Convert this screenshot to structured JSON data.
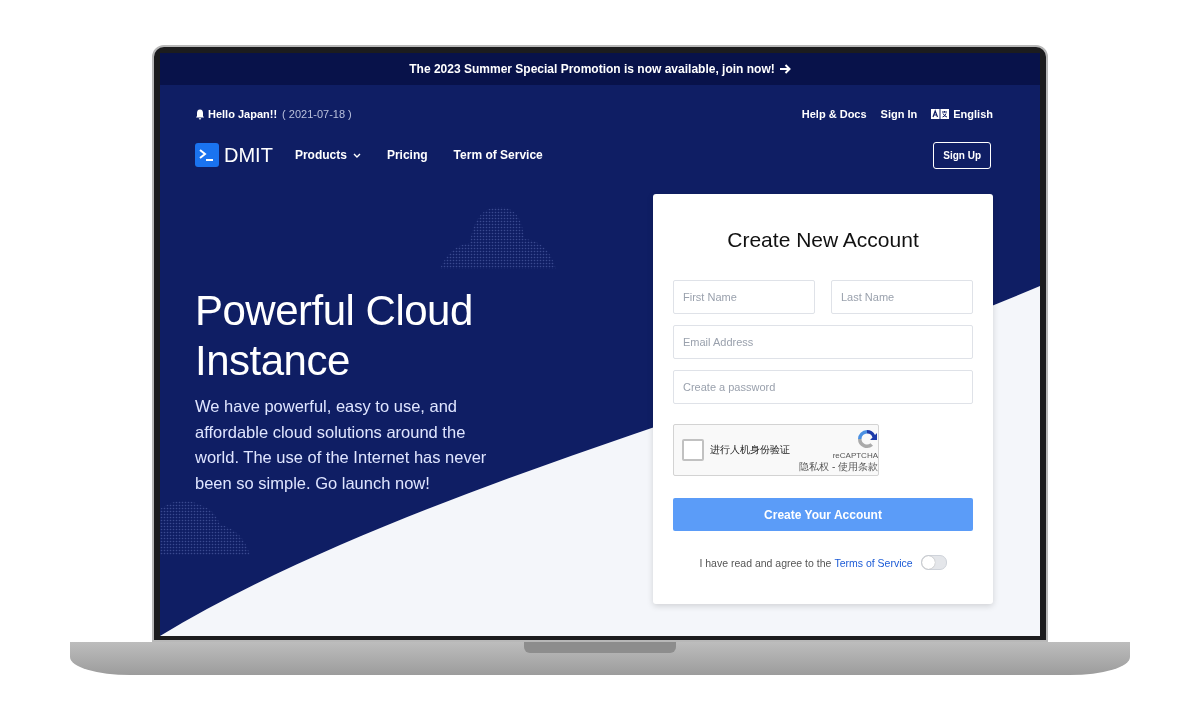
{
  "promo_bar": {
    "text": "The 2023 Summer Special Promotion is now available, join now!"
  },
  "top_bar": {
    "greeting": "Hello Japan!!",
    "date": "( 2021-07-18 )",
    "links": [
      "Help & Docs",
      "Sign In"
    ],
    "language": "English"
  },
  "nav": {
    "logo": "DMIT",
    "items": [
      {
        "label": "Products",
        "dropdown": true
      },
      {
        "label": "Pricing",
        "dropdown": false
      },
      {
        "label": "Term of Service",
        "dropdown": false
      }
    ],
    "signup_button": "Sign Up"
  },
  "hero": {
    "title": "Powerful Cloud Instance",
    "description": "We have powerful, easy to use, and affordable cloud solutions around the world. The use of the Internet has never been so simple. Go launch now!"
  },
  "signup_form": {
    "title": "Create New Account",
    "fields": [
      {
        "placeholder": "First Name",
        "kind": "half"
      },
      {
        "placeholder": "Last Name",
        "kind": "half"
      },
      {
        "placeholder": "Email Address",
        "kind": "full"
      },
      {
        "placeholder": "Create a password",
        "kind": "full"
      }
    ],
    "captcha": {
      "label": "进行人机身份验证",
      "checked": false,
      "brand": "reCAPTCHA",
      "links": "隐私权 - 使用条款"
    },
    "submit_button": "Create Your Account",
    "agreement": {
      "text": "I have read and agree to the",
      "link": "Terms of Service",
      "on": false
    }
  }
}
